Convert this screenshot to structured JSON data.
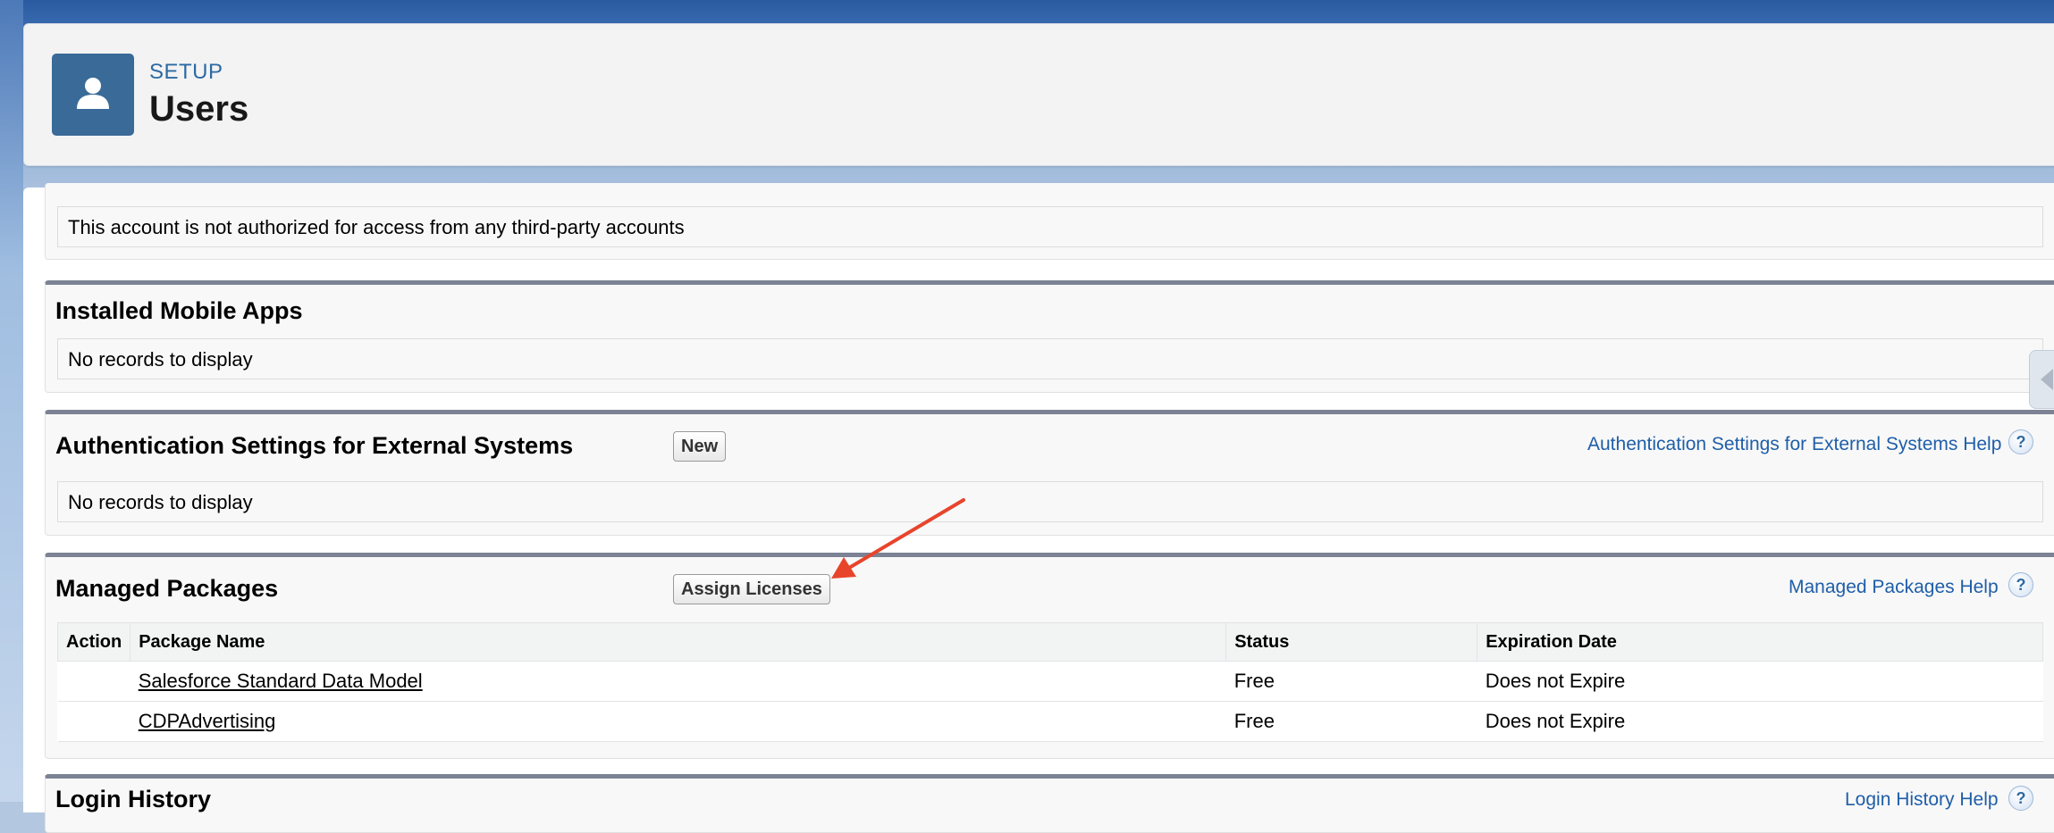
{
  "header": {
    "setup_label": "SETUP",
    "title": "Users",
    "icon": "user-icon"
  },
  "third_party": {
    "message": "This account is not authorized for access from any third-party accounts"
  },
  "installed_mobile_apps": {
    "title": "Installed Mobile Apps",
    "empty_text": "No records to display"
  },
  "auth_settings": {
    "title": "Authentication Settings for External Systems",
    "new_button": "New",
    "help_link": "Authentication Settings for External Systems Help",
    "empty_text": "No records to display"
  },
  "managed_packages": {
    "title": "Managed Packages",
    "assign_button": "Assign Licenses",
    "help_link": "Managed Packages Help",
    "columns": [
      "Action",
      "Package Name",
      "Status",
      "Expiration Date"
    ],
    "rows": [
      {
        "action": "",
        "package_name": "Salesforce Standard Data Model",
        "status": "Free",
        "expiration": "Does not Expire"
      },
      {
        "action": "",
        "package_name": "CDPAdvertising",
        "status": "Free",
        "expiration": "Does not Expire"
      }
    ]
  },
  "login_history": {
    "title": "Login History",
    "help_link": "Login History Help"
  },
  "colors": {
    "annotation_arrow": "#e8442c",
    "link": "#1f5ea8",
    "section_border": "#7b8394"
  }
}
